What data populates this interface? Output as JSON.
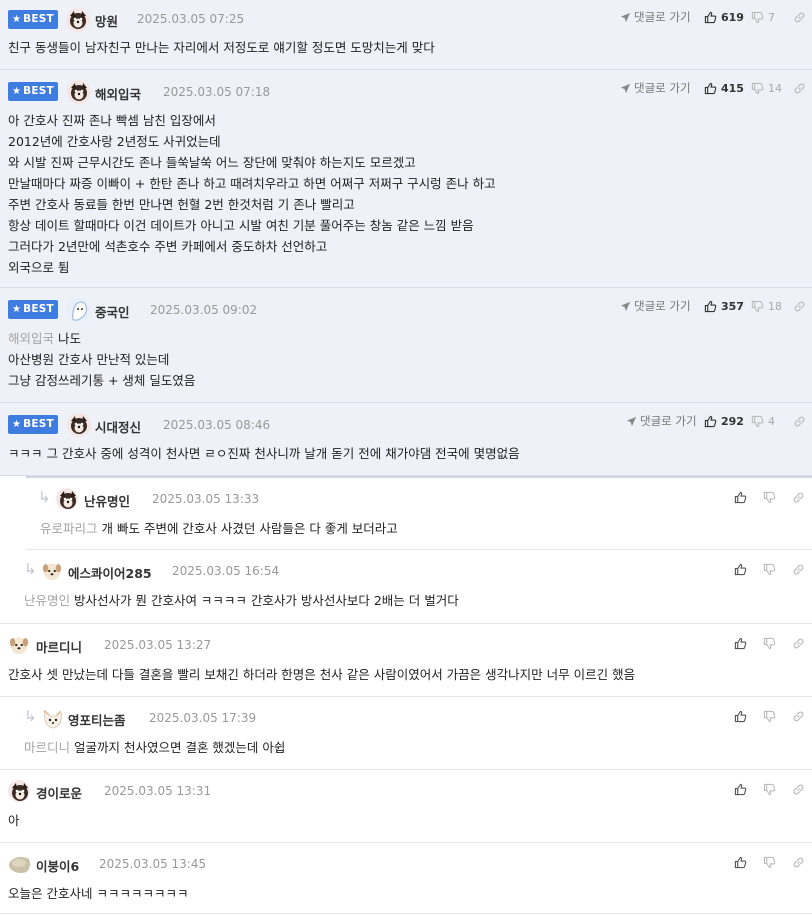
{
  "comments": [
    {
      "best": true,
      "badge": "BEST",
      "nickname": "망원",
      "date": "2025.03.05 07:25",
      "goto": "댓글로 가기",
      "likes": "619",
      "dislikes": "7",
      "lines": [
        "친구 동생들이 남자친구 만나는 자리에서 저정도로 얘기할 정도면 도망치는게 맞다"
      ]
    },
    {
      "best": true,
      "badge": "BEST",
      "nickname": "해외입국",
      "date": "2025.03.05 07:18",
      "goto": "댓글로 가기",
      "likes": "415",
      "dislikes": "14",
      "lines": [
        "아 간호사 진짜 존나 빡셈 남친 입장에서",
        "2012년에 간호사랑 2년정도 사귀었는데",
        "와 시발 진짜 근무시간도 존나 들쑥날쑥 어느 장단에 맞춰야 하는지도 모르겠고",
        "만날때마다 짜증 이빠이 + 한탄 존나 하고 때려치우라고 하면 어쩌구 저쩌구 구시렁 존나 하고",
        "주변 간호사 동료들 한번 만나면 헌혈 2번 한것처럼 기 존나 빨리고",
        "항상 데이트 할때마다 이건 데이트가 아니고 시발 여친 기분 풀어주는 창놈 같은 느낌 받음",
        "그러다가 2년만에 석촌호수 주변 카페에서 중도하차 선언하고",
        "외국으로 튐"
      ]
    },
    {
      "best": true,
      "badge": "BEST",
      "nickname": "중국인",
      "date": "2025.03.05 09:02",
      "goto": "댓글로 가기",
      "likes": "357",
      "dislikes": "18",
      "mention": "해외입국",
      "lines": [
        "나도",
        "아산병원 간호사 만난적 있는데",
        "그냥 감정쓰레기통 + 생체 딜도였음"
      ]
    },
    {
      "best": true,
      "badge": "BEST",
      "nickname": "시대정신",
      "date": "2025.03.05 08:46",
      "goto": "댓글로 가기",
      "likes": "292",
      "dislikes": "4",
      "lines": [
        "ㅋㅋㅋ 그 간호사 중에 성격이 천사면 ㄹㅇ진짜 천사니까 날개 돋기 전에 채가야댐 전국에 몇명없음"
      ]
    },
    {
      "best": false,
      "reply": true,
      "nickname": "난유명인",
      "date": "2025.03.05 13:33",
      "mention": "유로파리그",
      "lines": [
        "개 빠도 주변에 간호사 사겼던 사람들은 다 좋게 보더라고"
      ]
    },
    {
      "best": false,
      "reply": true,
      "nickname": "에스콰이어285",
      "date": "2025.03.05 16:54",
      "mention": "난유명인",
      "lines": [
        "방사선사가 뭔 간호사여 ㅋㅋㅋㅋ 간호사가 방사선사보다 2배는 더 벌거다"
      ]
    },
    {
      "best": false,
      "reply": false,
      "nickname": "마르디니",
      "date": "2025.03.05 13:27",
      "lines": [
        "간호사 셋 만났는데 다들 결혼을 빨리 보채긴 하더라 한명은 천사 같은 사람이였어서 가끔은 생각나지만 너무 이르긴 했음"
      ]
    },
    {
      "best": false,
      "reply": true,
      "nickname": "영포티는좀",
      "date": "2025.03.05 17:39",
      "mention": "마르디니",
      "lines": [
        "얼굴까지 천사였으면 결혼 했겠는데 아쉽"
      ]
    },
    {
      "best": false,
      "reply": false,
      "nickname": "경이로운",
      "date": "2025.03.05 13:31",
      "lines": [
        "아"
      ]
    },
    {
      "best": false,
      "reply": false,
      "nickname": "이붕이6",
      "date": "2025.03.05 13:45",
      "lines": [
        "오늘은 간호사네 ㅋㅋㅋㅋㅋㅋㅋㅋ"
      ]
    }
  ],
  "colors": {
    "best_badge": "#3f7ce0",
    "best_bg": "#eef1f7",
    "mention": "#a3a3a3",
    "date": "#999999"
  },
  "icons": {
    "badge": "star-icon",
    "goto": "send-icon",
    "like": "thumbs-up-icon",
    "dislike": "thumbs-down-icon",
    "share": "link-icon",
    "reply": "reply-arrow-icon"
  }
}
